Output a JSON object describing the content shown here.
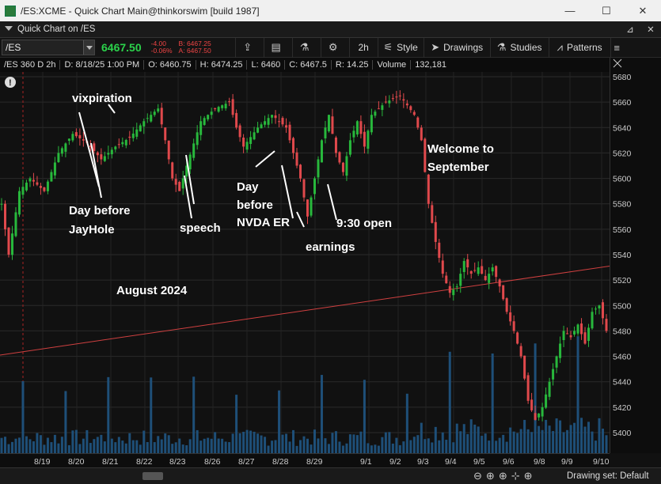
{
  "window": {
    "title": "/ES:XCME - Quick Chart Main@thinkorswim [build 1987]",
    "minimize": "—",
    "maximize": "☐",
    "close": "✕"
  },
  "panel": {
    "label": "Quick Chart on /ES",
    "pin": "📌",
    "close": "✕"
  },
  "toolbar": {
    "symbol": "/ES",
    "last_price": "6467.50",
    "change": "-4.00",
    "change_pct": "-0.06%",
    "bid": "B: 6467.25",
    "ask": "A: 6467.50",
    "timeframe": "2h",
    "style": "Style",
    "drawings": "Drawings",
    "studies": "Studies",
    "patterns": "Patterns"
  },
  "infobar": {
    "symbol_period": "/ES 360 D 2h",
    "date": "D: 8/18/25 1:00 PM",
    "open": "O: 6460.75",
    "high": "H: 6474.25",
    "low": "L: 6460",
    "close": "C: 6467.5",
    "range": "R: 14.25",
    "volume_label": "Volume",
    "volume": "132,181"
  },
  "annotations": {
    "vixpiration": "vixpiration",
    "day_before_jayhole_1": "Day before",
    "day_before_jayhole_2": "JayHole",
    "speech": "speech",
    "nvda_1": "Day",
    "nvda_2": "before",
    "nvda_3": "NVDA ER",
    "earnings": "earnings",
    "open_930": "9:30 open",
    "welcome_1": "Welcome to",
    "welcome_2": "September",
    "month": "August 2024"
  },
  "chart_data": {
    "type": "candlestick",
    "title": "",
    "xlabel": "",
    "ylabel": "",
    "ylim": [
      5390,
      5690
    ],
    "yticks": [
      5400,
      5420,
      5440,
      5460,
      5480,
      5500,
      5520,
      5540,
      5560,
      5580,
      5600,
      5620,
      5640,
      5660,
      5680
    ],
    "xticks": [
      "8/19",
      "8/20",
      "8/21",
      "8/22",
      "8/23",
      "8/26",
      "8/27",
      "8/28",
      "8/29",
      "9/1",
      "9/2",
      "9/3",
      "9/4",
      "9/5",
      "9/6",
      "9/8",
      "9/9",
      "9/10"
    ],
    "close_path": [
      [
        0,
        5580
      ],
      [
        2,
        5540
      ],
      [
        5,
        5590
      ],
      [
        8,
        5600
      ],
      [
        12,
        5590
      ],
      [
        16,
        5620
      ],
      [
        20,
        5635
      ],
      [
        24,
        5628
      ],
      [
        28,
        5615
      ],
      [
        32,
        5625
      ],
      [
        36,
        5632
      ],
      [
        40,
        5645
      ],
      [
        44,
        5655
      ],
      [
        46,
        5630
      ],
      [
        48,
        5600
      ],
      [
        50,
        5590
      ],
      [
        52,
        5610
      ],
      [
        56,
        5645
      ],
      [
        60,
        5655
      ],
      [
        64,
        5660
      ],
      [
        66,
        5640
      ],
      [
        68,
        5625
      ],
      [
        72,
        5640
      ],
      [
        76,
        5650
      ],
      [
        80,
        5640
      ],
      [
        82,
        5620
      ],
      [
        84,
        5600
      ],
      [
        86,
        5570
      ],
      [
        88,
        5600
      ],
      [
        90,
        5630
      ],
      [
        92,
        5650
      ],
      [
        94,
        5620
      ],
      [
        96,
        5605
      ],
      [
        98,
        5630
      ],
      [
        100,
        5645
      ],
      [
        102,
        5625
      ],
      [
        104,
        5650
      ],
      [
        108,
        5660
      ],
      [
        112,
        5665
      ],
      [
        116,
        5650
      ],
      [
        118,
        5630
      ],
      [
        120,
        5580
      ],
      [
        122,
        5550
      ],
      [
        124,
        5525
      ],
      [
        126,
        5510
      ],
      [
        128,
        5515
      ],
      [
        130,
        5535
      ],
      [
        132,
        5525
      ],
      [
        134,
        5530
      ],
      [
        136,
        5520
      ],
      [
        138,
        5530
      ],
      [
        140,
        5515
      ],
      [
        142,
        5495
      ],
      [
        144,
        5480
      ],
      [
        146,
        5460
      ],
      [
        148,
        5425
      ],
      [
        150,
        5410
      ],
      [
        152,
        5420
      ],
      [
        154,
        5440
      ],
      [
        156,
        5460
      ],
      [
        158,
        5480
      ],
      [
        160,
        5475
      ],
      [
        162,
        5485
      ],
      [
        164,
        5470
      ],
      [
        166,
        5495
      ],
      [
        168,
        5500
      ],
      [
        170,
        5480
      ]
    ],
    "trendline": {
      "from": [
        "8/18",
        5461
      ],
      "to": [
        "9/10",
        5531
      ]
    },
    "volume_series": "Volume"
  }
}
